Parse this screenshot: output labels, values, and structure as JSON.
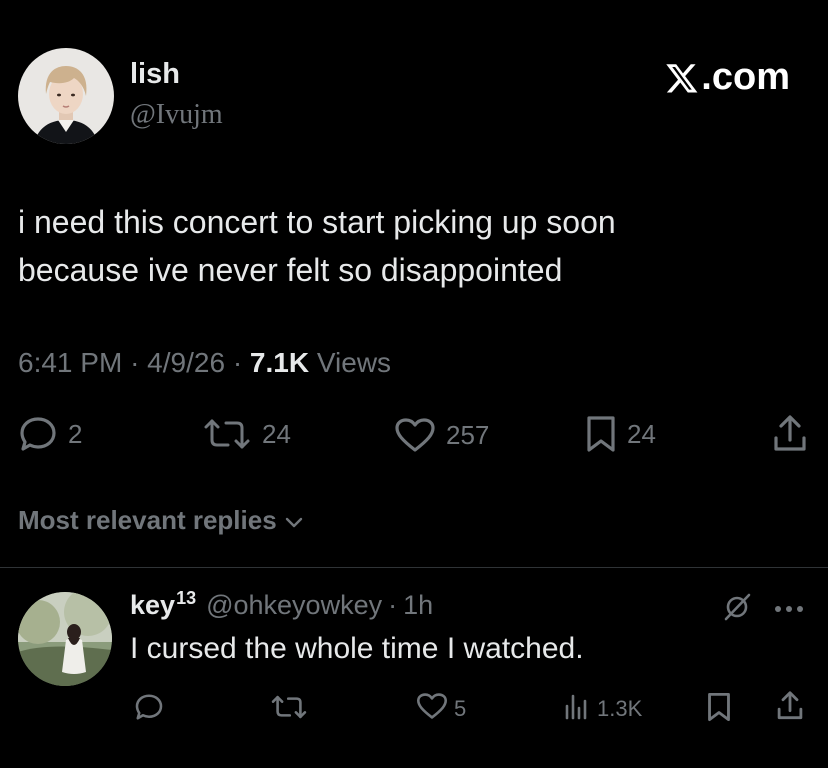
{
  "post": {
    "display_name": "lish",
    "handle": "@Ivujm",
    "brand": ".com",
    "text_line1": "i need this concert to start picking up soon",
    "text_line2": "because ive never felt so disappointed",
    "time": "6:41 PM",
    "date": "4/9/26",
    "views_count": "7.1K",
    "views_label": "Views",
    "separator": "·"
  },
  "actions": {
    "replies": "2",
    "reposts": "24",
    "likes": "257",
    "bookmarks": "24"
  },
  "sort": {
    "label": "Most relevant replies"
  },
  "reply": {
    "name": "key",
    "name_sup": "13",
    "handle": "@ohkeyowkey",
    "separator": "·",
    "time": "1h",
    "text": "I cursed the whole time I watched.",
    "likes": "5",
    "views": "1.3K"
  },
  "colors": {
    "background": "#000000",
    "text": "#e7e9ea",
    "muted": "#71767b",
    "divider": "#2f3336"
  }
}
